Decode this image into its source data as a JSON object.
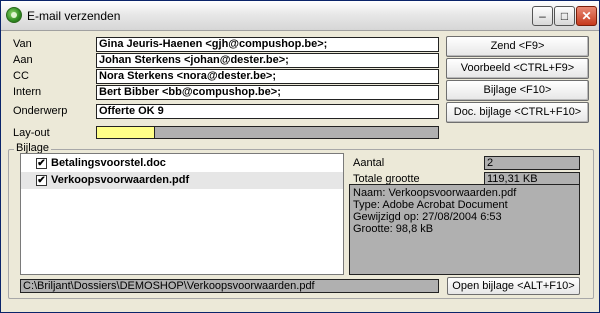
{
  "window": {
    "title": "E-mail verzenden",
    "minimize": "–",
    "maximize": "□",
    "close": "✕"
  },
  "form": {
    "from_label": "Van",
    "from_value": "Gina Jeuris-Haenen <gjh@compushop.be>;",
    "to_label": "Aan",
    "to_value": "Johan Sterkens <johan@dester.be>;",
    "cc_label": "CC",
    "cc_value": "Nora Sterkens <nora@dester.be>;",
    "internal_label": "Intern",
    "internal_value": "Bert Bibber <bb@compushop.be>;",
    "subject_label": "Onderwerp",
    "subject_value": "Offerte OK 9",
    "layout_label": "Lay-out",
    "layout_fill_fraction": 0.17,
    "layout_fill_color": "#ffff88"
  },
  "buttons": {
    "send": "Zend <F9>",
    "preview": "Voorbeeld <CTRL+F9>",
    "attachment": "Bijlage <F10>",
    "doc_attachment": "Doc. bijlage <CTRL+F10>",
    "open_attachment": "Open bijlage <ALT+F10>"
  },
  "attachments": {
    "group_label": "Bijlage",
    "files": [
      {
        "name": "Betalingsvoorstel.doc",
        "checked": true,
        "selected": false
      },
      {
        "name": "Verkoopsvoorwaarden.pdf",
        "checked": true,
        "selected": true
      }
    ],
    "count_label": "Aantal",
    "count_value": "2",
    "total_size_label": "Totale grootte",
    "total_size_value": "119,31 KB",
    "details": [
      "Naam: Verkoopsvoorwaarden.pdf",
      "Type: Adobe Acrobat Document",
      "Gewijzigd op: 27/08/2004 6:53",
      "Grootte: 98,8 kB"
    ],
    "path": "C:\\Briljant\\Dossiers\\DEMOSHOP\\Verkoopsvoorwaarden.pdf"
  }
}
